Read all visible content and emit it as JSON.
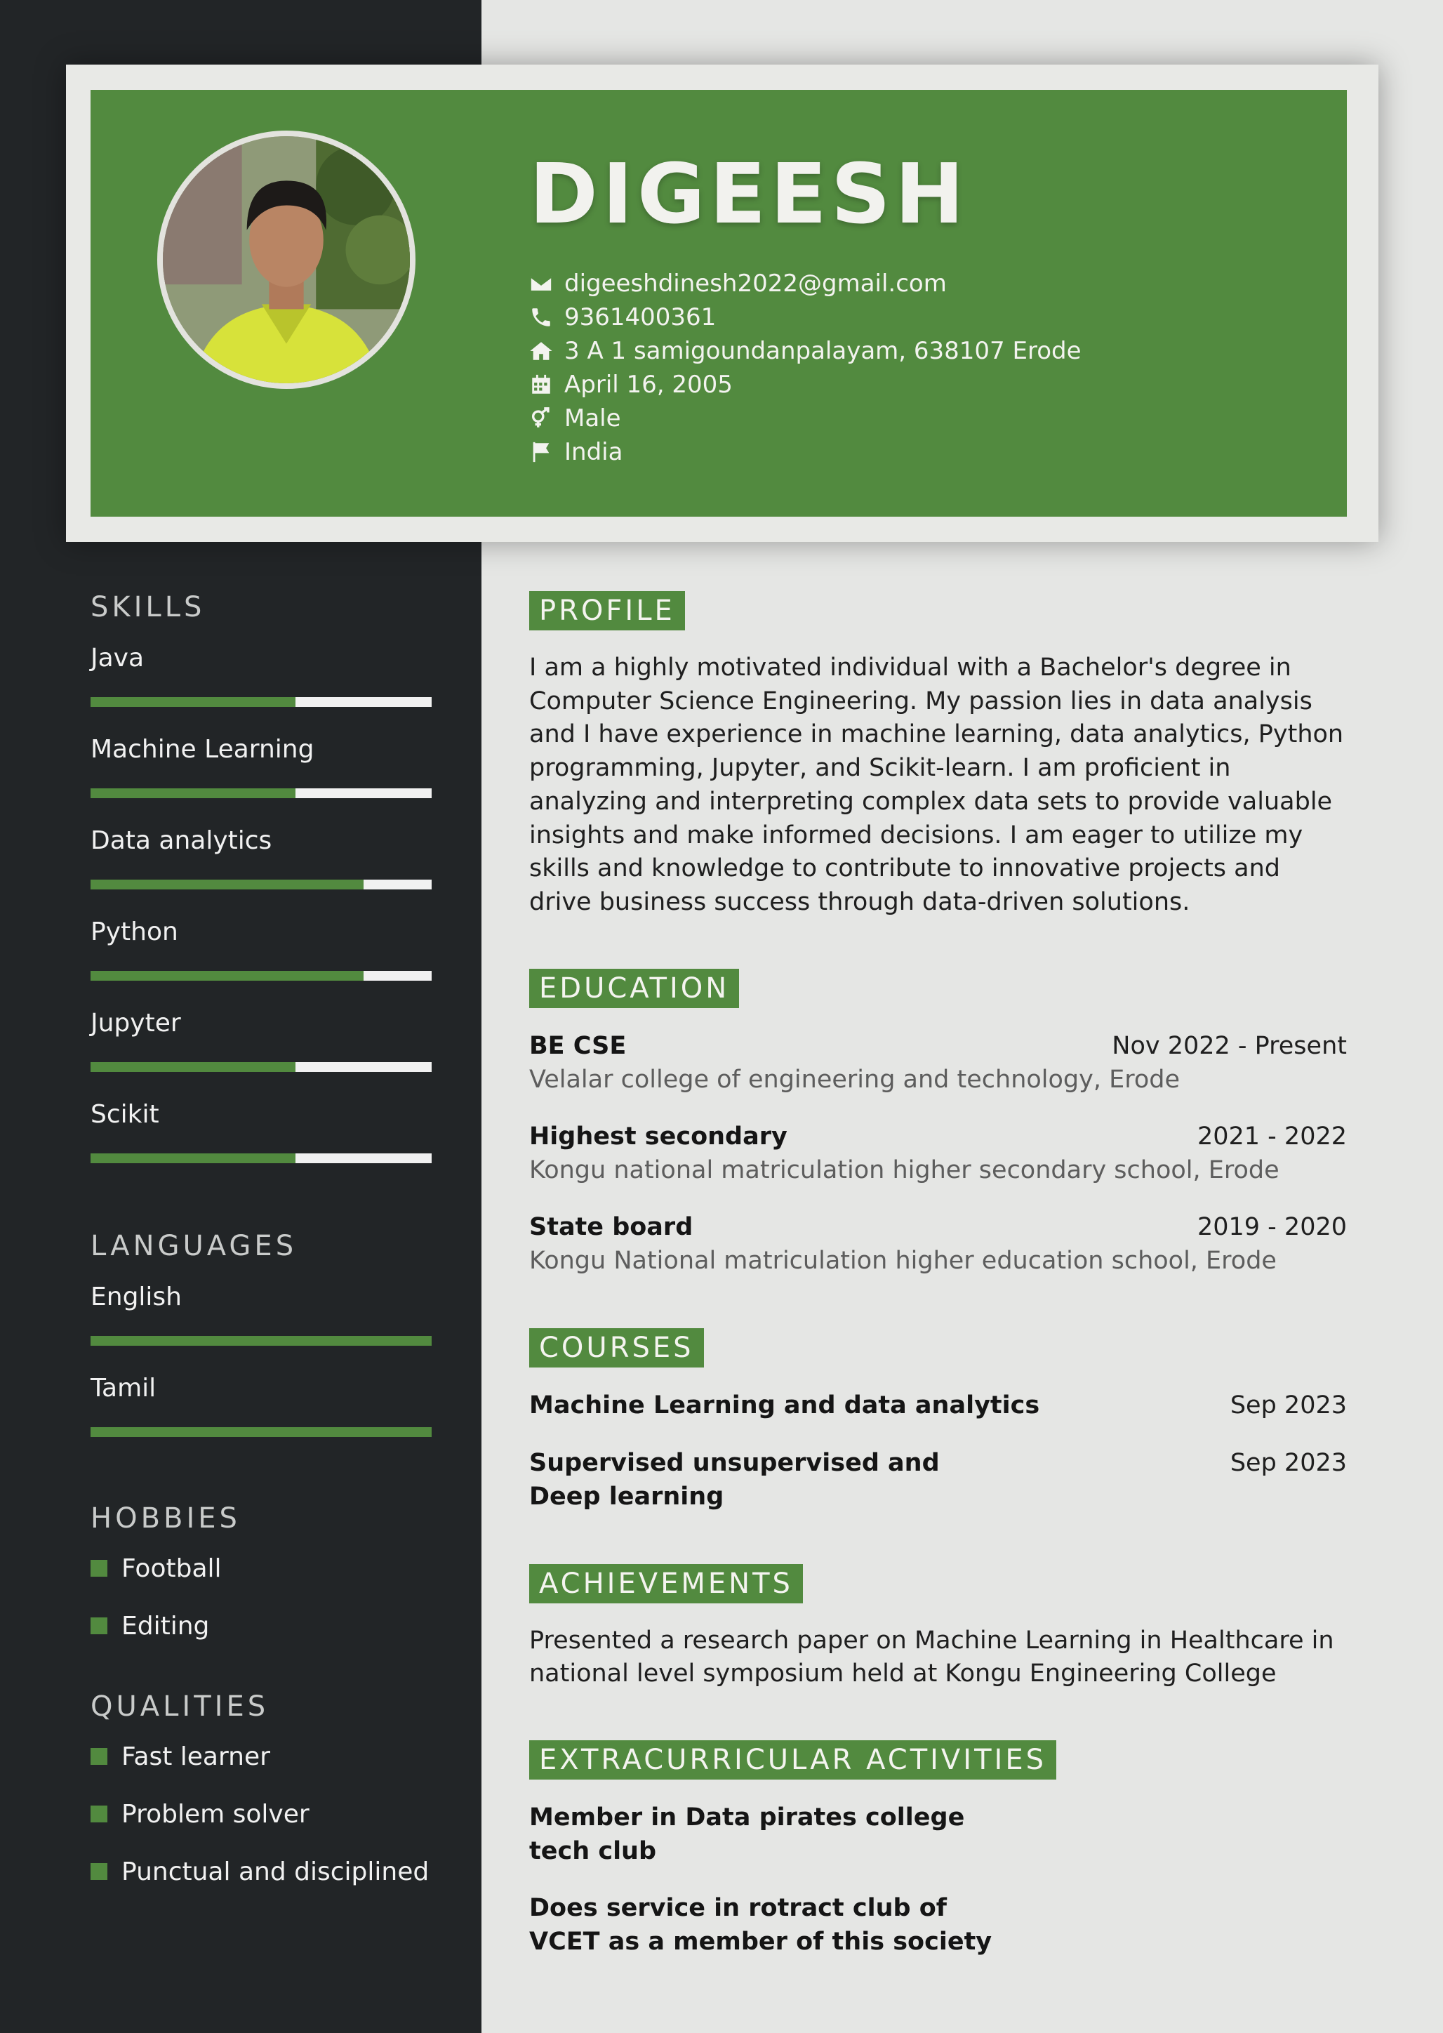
{
  "header": {
    "name": "DIGEESH",
    "contacts": [
      {
        "icon": "envelope-icon",
        "text": "digeeshdinesh2022@gmail.com"
      },
      {
        "icon": "phone-icon",
        "text": "9361400361"
      },
      {
        "icon": "home-icon",
        "text": "3 A 1 samigoundanpalayam, 638107 Erode"
      },
      {
        "icon": "calendar-icon",
        "text": "April 16, 2005"
      },
      {
        "icon": "gender-icon",
        "text": "Male"
      },
      {
        "icon": "flag-icon",
        "text": "India"
      }
    ]
  },
  "sidebar": {
    "skills_title": "SKILLS",
    "skills": [
      {
        "label": "Java",
        "level": 0.6
      },
      {
        "label": "Machine Learning",
        "level": 0.6
      },
      {
        "label": "Data analytics",
        "level": 0.8
      },
      {
        "label": "Python",
        "level": 0.8
      },
      {
        "label": "Jupyter",
        "level": 0.6
      },
      {
        "label": "Scikit",
        "level": 0.6
      }
    ],
    "languages_title": "LANGUAGES",
    "languages": [
      {
        "label": "English",
        "level": 1.0
      },
      {
        "label": "Tamil",
        "level": 1.0
      }
    ],
    "hobbies_title": "HOBBIES",
    "hobbies": [
      "Football",
      "Editing"
    ],
    "qualities_title": "QUALITIES",
    "qualities": [
      "Fast learner",
      "Problem solver",
      "Punctual and disciplined"
    ]
  },
  "main": {
    "profile_title": "PROFILE",
    "profile_text": "I am a highly motivated individual with a Bachelor's degree in Computer Science Engineering. My passion lies in data analysis and I have experience in machine learning, data analytics, Python programming, Jupyter, and Scikit-learn. I am proficient in analyzing and interpreting complex data sets to provide valuable insights and make informed decisions. I am eager to utilize my skills and knowledge to contribute to innovative projects and drive business success through data-driven solutions.",
    "education_title": "EDUCATION",
    "education": [
      {
        "degree": "BE CSE",
        "date": "Nov 2022 - Present",
        "school": "Velalar college of engineering and technology, Erode"
      },
      {
        "degree": "Highest secondary",
        "date": "2021 - 2022",
        "school": "Kongu national matriculation higher secondary school, Erode"
      },
      {
        "degree": "State board",
        "date": "2019 - 2020",
        "school": "Kongu National matriculation higher education school, Erode"
      }
    ],
    "courses_title": "COURSES",
    "courses": [
      {
        "name": "Machine Learning and data analytics",
        "date": "Sep 2023"
      },
      {
        "name": "Supervised unsupervised and Deep learning",
        "date": "Sep 2023"
      }
    ],
    "achievements_title": "ACHIEVEMENTS",
    "achievements_text": "Presented a research paper on Machine Learning in Healthcare in national level symposium held at Kongu Engineering College",
    "extracurricular_title": "EXTRACURRICULAR ACTIVITIES",
    "extracurricular": [
      "Member in Data pirates college tech club",
      "Does service in rotract club of VCET as a member of this society"
    ]
  },
  "colors": {
    "accent": "#528a3f",
    "sidebar": "#222527",
    "page": "#e5e6e4"
  }
}
